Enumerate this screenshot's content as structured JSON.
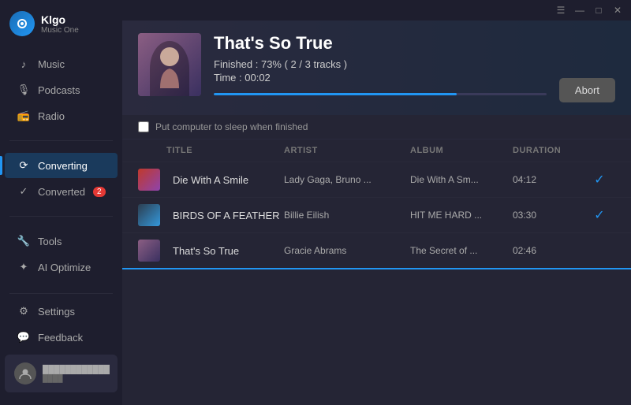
{
  "app": {
    "name": "Klgo",
    "subtitle": "Music One"
  },
  "window_buttons": {
    "menu": "☰",
    "minimize": "—",
    "maximize": "□",
    "close": "✕"
  },
  "sidebar": {
    "nav_items": [
      {
        "id": "music",
        "label": "Music",
        "active": false
      },
      {
        "id": "podcasts",
        "label": "Podcasts",
        "active": false
      },
      {
        "id": "radio",
        "label": "Radio",
        "active": false
      }
    ],
    "convert_items": [
      {
        "id": "converting",
        "label": "Converting",
        "active": true,
        "badge": null
      },
      {
        "id": "converted",
        "label": "Converted",
        "active": false,
        "badge": "2"
      }
    ],
    "tool_items": [
      {
        "id": "tools",
        "label": "Tools",
        "active": false
      },
      {
        "id": "ai-optimize",
        "label": "AI Optimize",
        "active": false
      }
    ],
    "bottom_items": [
      {
        "id": "settings",
        "label": "Settings",
        "active": false
      },
      {
        "id": "feedback",
        "label": "Feedback",
        "active": false
      }
    ],
    "user": {
      "name": "user@example.com",
      "plan": "plan"
    }
  },
  "convert_header": {
    "title": "That's So True",
    "status_label": "Finished : 73% ( 2 / 3 tracks )",
    "time_label": "Time : 00:02",
    "progress_percent": 73,
    "abort_label": "Abort",
    "sleep_label": "Put computer to sleep when finished"
  },
  "table": {
    "columns": [
      "",
      "TITLE",
      "ARTIST",
      "ALBUM",
      "DURATION",
      ""
    ],
    "rows": [
      {
        "id": 1,
        "title": "Die With A Smile",
        "artist": "Lady Gaga, Bruno ...",
        "album": "Die With A Sm...",
        "duration": "04:12",
        "status": "done",
        "thumb_class": "track-thumb-1"
      },
      {
        "id": 2,
        "title": "BIRDS OF A FEATHER",
        "artist": "Billie Eilish",
        "album": "HIT ME HARD ...",
        "duration": "03:30",
        "status": "done",
        "thumb_class": "track-thumb-2"
      },
      {
        "id": 3,
        "title": "That's So True",
        "artist": "Gracie Abrams",
        "album": "The Secret of ...",
        "duration": "02:46",
        "status": "converting",
        "thumb_class": "track-thumb-3"
      }
    ]
  }
}
